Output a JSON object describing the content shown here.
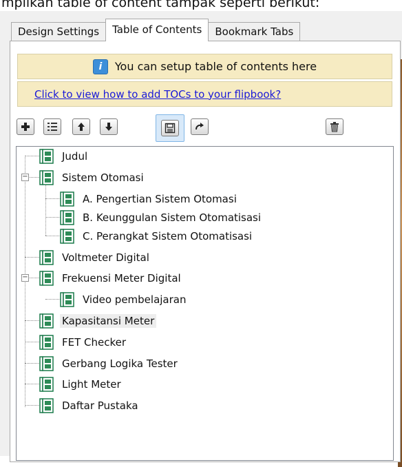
{
  "caption": "mpilkan table of content tampak seperti berikut:",
  "tabs": [
    {
      "label": "Design Settings",
      "active": false
    },
    {
      "label": "Table of Contents",
      "active": true
    },
    {
      "label": "Bookmark Tabs",
      "active": false
    }
  ],
  "info": {
    "text": "You can setup table of contents here",
    "icon": "info-icon"
  },
  "help_link": {
    "text": "Click to view how to add TOCs to your flipbook?"
  },
  "toolbar": [
    {
      "name": "add-button",
      "icon": "plus-icon"
    },
    {
      "name": "properties-button",
      "icon": "list-icon"
    },
    {
      "name": "move-up-button",
      "icon": "arrow-up-icon"
    },
    {
      "name": "move-down-button",
      "icon": "arrow-down-icon"
    },
    {
      "name": "save-button",
      "icon": "save-icon",
      "pressed": true
    },
    {
      "name": "redo-button",
      "icon": "redo-icon"
    },
    {
      "name": "delete-button",
      "icon": "trash-icon"
    }
  ],
  "tree": {
    "items": [
      {
        "label": "Judul",
        "level": 0
      },
      {
        "label": "Sistem Otomasi",
        "level": 0,
        "expanded": true
      },
      {
        "label": "A. Pengertian Sistem Otomasi",
        "level": 1
      },
      {
        "label": "B. Keunggulan Sistem Otomatisasi",
        "level": 1
      },
      {
        "label": "C. Perangkat Sistem Otomatisasi",
        "level": 1
      },
      {
        "label": "Voltmeter Digital",
        "level": 0
      },
      {
        "label": "Frekuensi Meter Digital",
        "level": 0,
        "expanded": true
      },
      {
        "label": "Video pembelajaran",
        "level": 1
      },
      {
        "label": "Kapasitansi Meter",
        "level": 0,
        "selected": true
      },
      {
        "label": "FET Checker",
        "level": 0
      },
      {
        "label": "Gerbang Logika Tester",
        "level": 0
      },
      {
        "label": "Light Meter",
        "level": 0
      },
      {
        "label": "Daftar Pustaka",
        "level": 0
      }
    ]
  },
  "colors": {
    "info_bg": "#f6ebc2",
    "link": "#1a1ad8",
    "pressed_bg": "#d8e9f9",
    "book_icon": "#1a7a4a"
  }
}
